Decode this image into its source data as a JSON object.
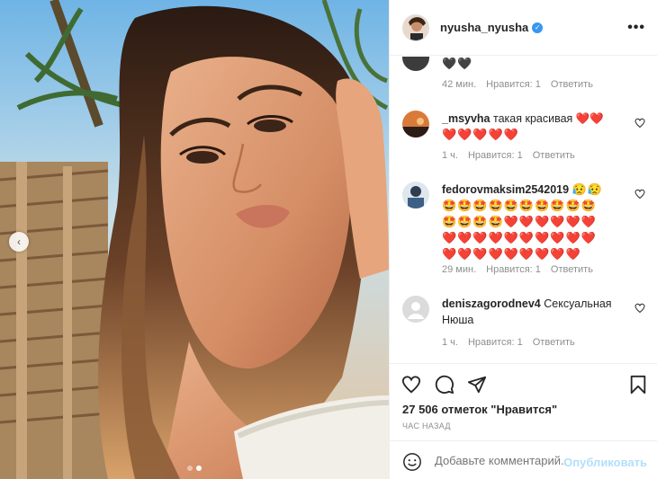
{
  "post": {
    "username": "nyusha_nyusha",
    "verified": "✓",
    "more": "•••",
    "likes": "27 506 отметок \"Нравится\"",
    "time_ago": "ЧАС НАЗАД",
    "carousel_dots": 2,
    "carousel_active": 2
  },
  "comments": [
    {
      "username": "",
      "text": "🖤🖤",
      "time": "42 мин.",
      "likes": "Нравится: 1",
      "reply": "Ответить"
    },
    {
      "username": "_msyvha",
      "text": "такая красивая ❤️❤️",
      "text2": "❤️❤️❤️❤️❤️",
      "time": "1 ч.",
      "likes": "Нравится: 1",
      "reply": "Ответить"
    },
    {
      "username": "fedorovmaksim2542019",
      "text": "😥😥",
      "text2": "🤩🤩🤩🤩🤩🤩🤩🤩🤩🤩",
      "text3": "🤩🤩🤩🤩❤️❤️❤️❤️❤️❤️",
      "text4": "❤️❤️❤️❤️❤️❤️❤️❤️❤️❤️",
      "text5": "❤️❤️❤️❤️❤️❤️❤️❤️❤️",
      "time": "29 мин.",
      "likes": "Нравится: 1",
      "reply": "Ответить"
    },
    {
      "username": "deniszagorodnev4",
      "text": "Сексуальная Нюша",
      "time": "1 ч.",
      "likes": "Нравится: 1",
      "reply": "Ответить"
    }
  ],
  "add_comment": {
    "placeholder": "Добавьте комментарий...",
    "publish": "Опубликовать"
  },
  "icons": {
    "like": "heart-icon",
    "comment": "comment-icon",
    "share": "paper-plane-icon",
    "save": "bookmark-icon",
    "emoji": "smile-icon",
    "prev": "chevron-left-icon"
  },
  "colors": {
    "verified": "#3897f0",
    "publish": "#b2dffc",
    "meta": "#8e8e8e"
  }
}
